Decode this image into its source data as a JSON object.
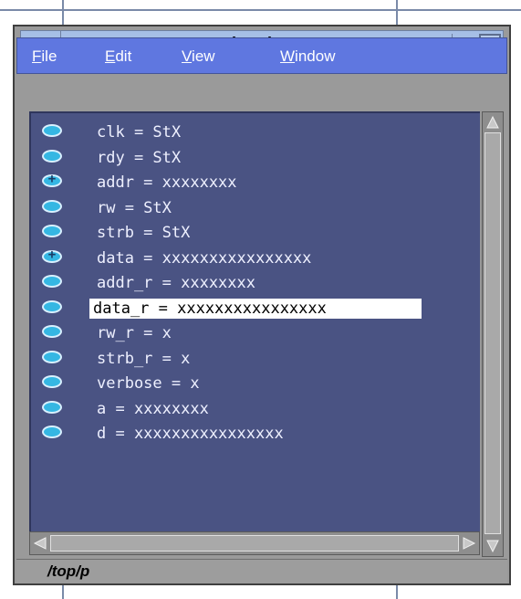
{
  "window": {
    "title": "signals"
  },
  "menu": [
    {
      "label": "File"
    },
    {
      "label": "Edit"
    },
    {
      "label": "View"
    },
    {
      "label": "Window"
    }
  ],
  "signals": [
    {
      "text": "clk = StX",
      "expandable": false,
      "selected": false
    },
    {
      "text": "rdy = StX",
      "expandable": false,
      "selected": false
    },
    {
      "text": "addr = xxxxxxxx",
      "expandable": true,
      "selected": false
    },
    {
      "text": "rw = StX",
      "expandable": false,
      "selected": false
    },
    {
      "text": "strb = StX",
      "expandable": false,
      "selected": false
    },
    {
      "text": "data = xxxxxxxxxxxxxxxx",
      "expandable": true,
      "selected": false
    },
    {
      "text": "addr_r = xxxxxxxx",
      "expandable": false,
      "selected": false
    },
    {
      "text": "data_r = xxxxxxxxxxxxxxxx",
      "expandable": false,
      "selected": true
    },
    {
      "text": "rw_r = x",
      "expandable": false,
      "selected": false
    },
    {
      "text": "strb_r = x",
      "expandable": false,
      "selected": false
    },
    {
      "text": "verbose = x",
      "expandable": false,
      "selected": false
    },
    {
      "text": "a = xxxxxxxx",
      "expandable": false,
      "selected": false
    },
    {
      "text": "d = xxxxxxxxxxxxxxxx",
      "expandable": false,
      "selected": false
    }
  ],
  "status": {
    "path": "/top/p"
  },
  "colors": {
    "menubar": "#5f77e0",
    "list_background": "#4a5383",
    "signal_icon": "#35b7e3",
    "selection": "#ffffff"
  }
}
